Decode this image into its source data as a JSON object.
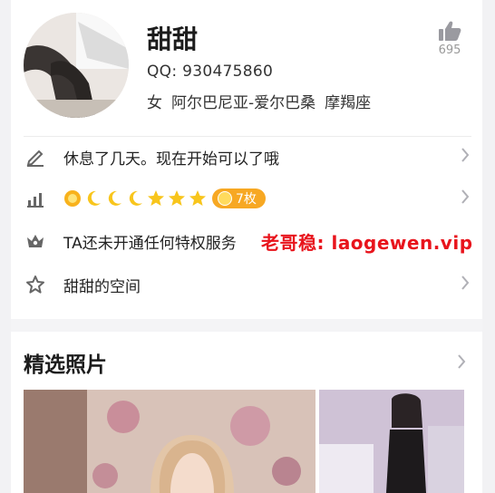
{
  "profile": {
    "name": "甜甜",
    "qq": "QQ: 930475860",
    "gender": "女",
    "location": "阿尔巴尼亚-爱尔巴桑",
    "zodiac": "摩羯座",
    "likes": "695"
  },
  "rows": {
    "signature": "休息了几天。现在开始可以了哦",
    "level_badge": "7枚",
    "vip_status": "TA还未开通任何特权服务",
    "space": "甜甜的空间"
  },
  "watermark": "老哥稳: laogewen.vip",
  "section": {
    "title": "精选照片"
  },
  "icons": {
    "like": "thumbs-up-icon",
    "signature": "pencil-icon",
    "level": "level-chart-icon",
    "vip": "crown-icon",
    "space": "star-icon",
    "chevron": "chevron-right-icon"
  },
  "colors": {
    "badge": "#f7a823",
    "watermark": "#e8141c",
    "star": "#f8c51c"
  }
}
